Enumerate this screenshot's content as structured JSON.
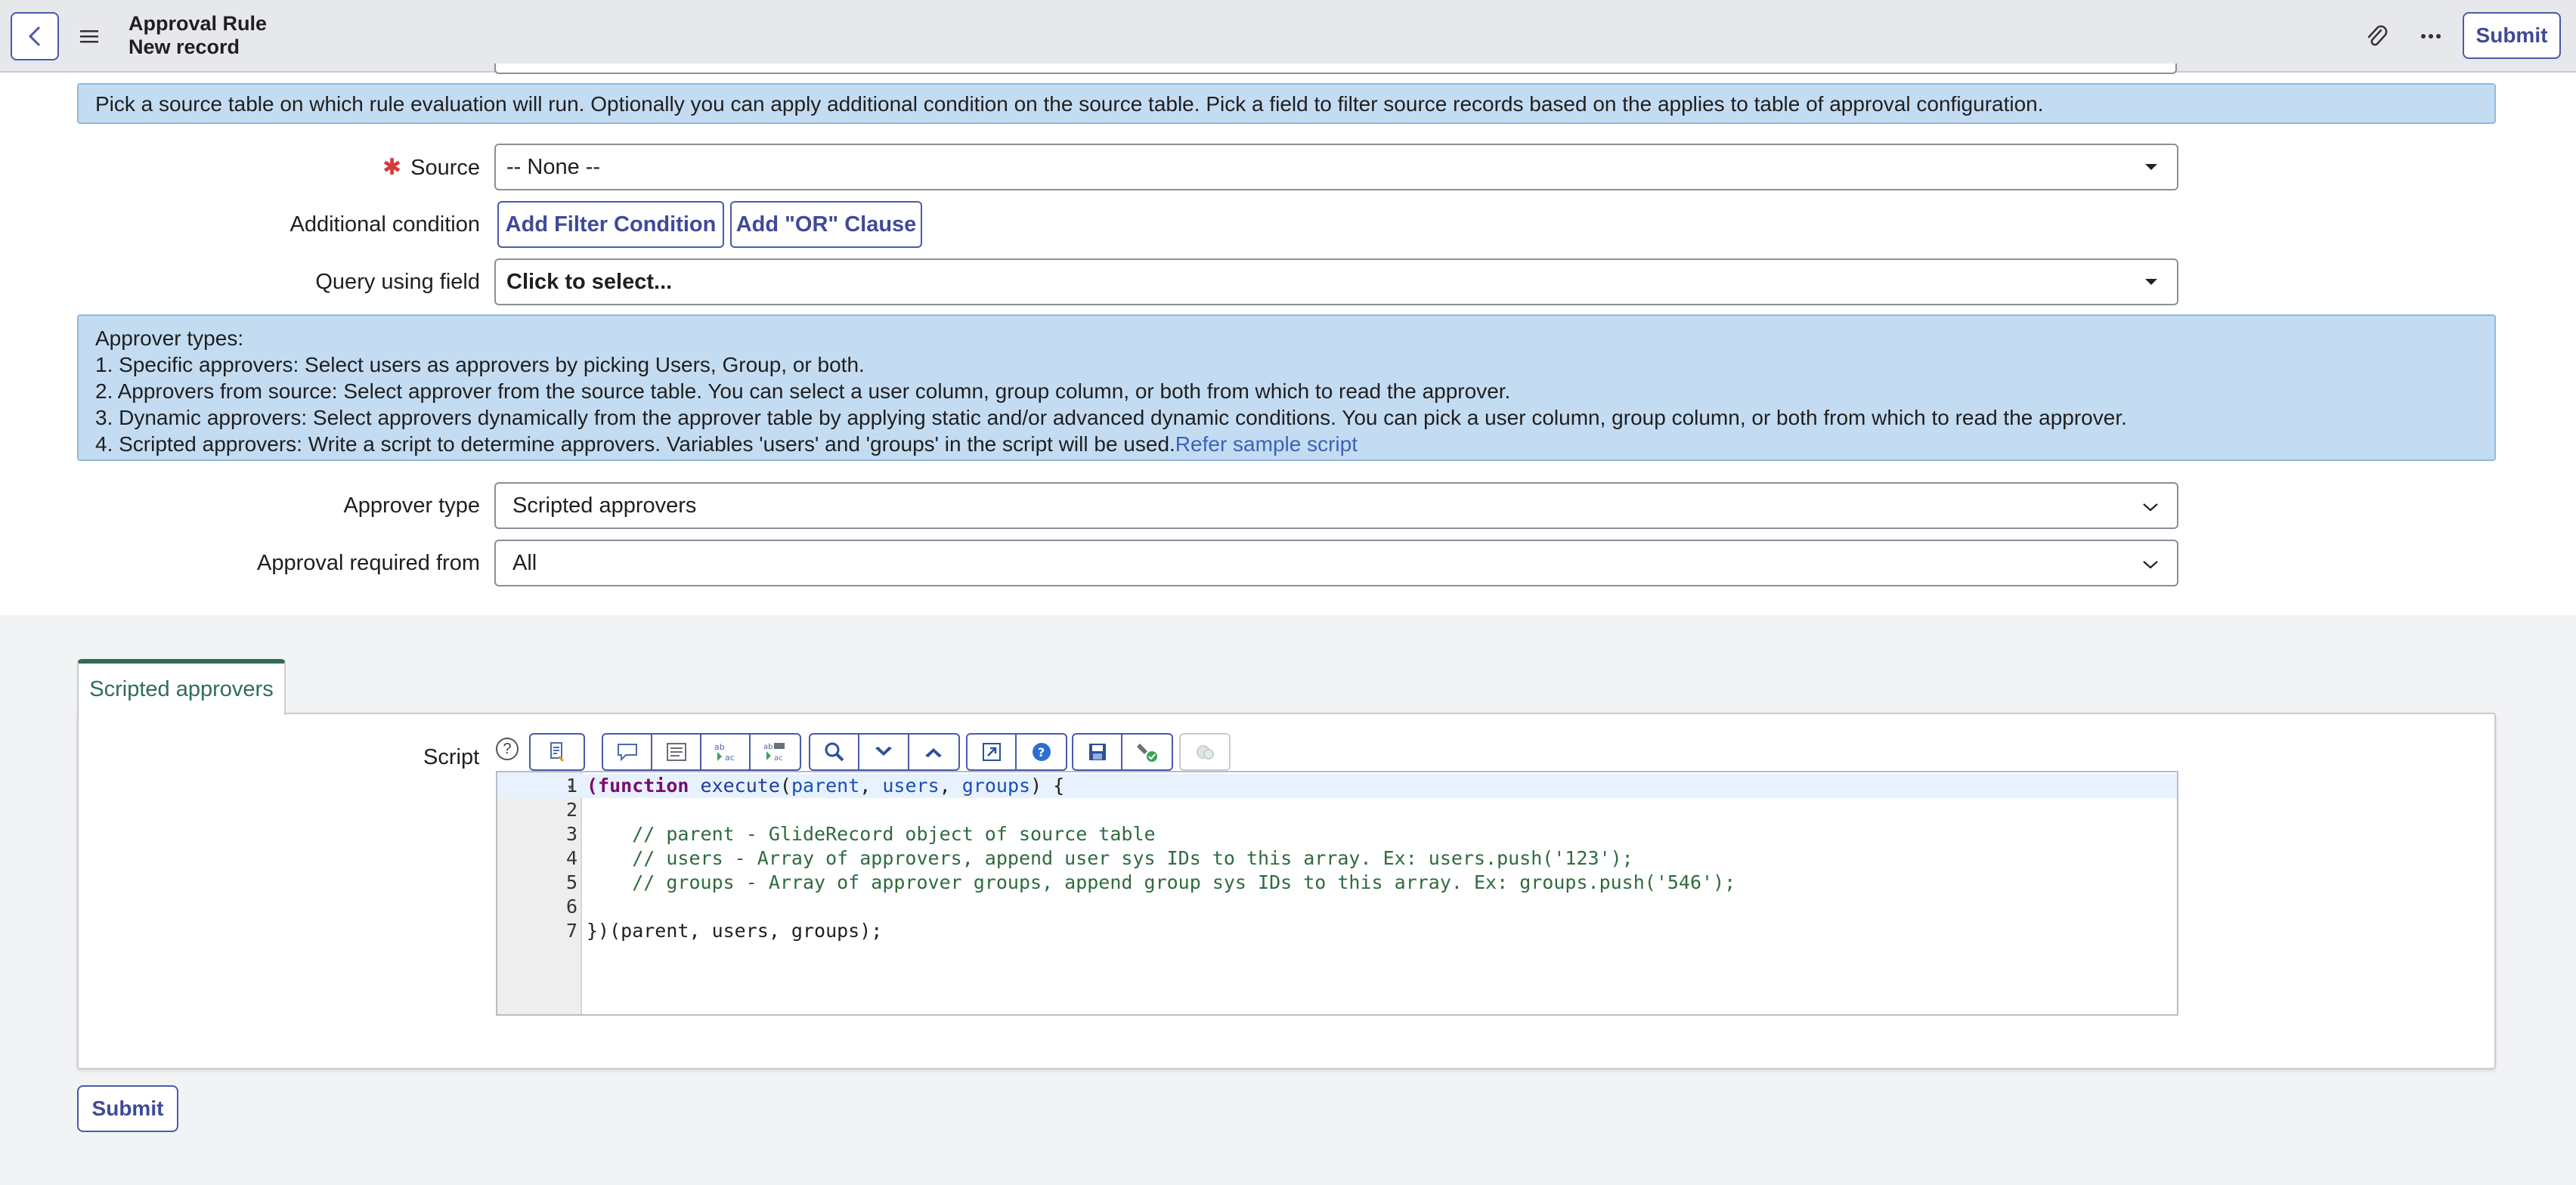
{
  "header": {
    "title": "Approval Rule",
    "subtitle": "New record",
    "submit_label": "Submit",
    "icons": [
      "back-icon",
      "menu-icon",
      "attachment-icon",
      "more-icon"
    ]
  },
  "info_source": "Pick a source table on which rule evaluation will run. Optionally you can apply additional condition on the source table. Pick a field to filter source records based on the applies to table of approval configuration.",
  "form": {
    "source": {
      "label": "Source",
      "required_mark": "✱",
      "value": "-- None --"
    },
    "additional_condition": {
      "label": "Additional condition",
      "add_filter_label": "Add Filter Condition",
      "add_or_label": "Add \"OR\" Clause"
    },
    "query_field": {
      "label": "Query using field",
      "value": "Click to select..."
    },
    "approver_type": {
      "label": "Approver type",
      "value": "Scripted approvers"
    },
    "approval_required": {
      "label": "Approval required from",
      "value": "All"
    }
  },
  "info_approver": {
    "heading": "Approver types:",
    "line1": "1. Specific approvers: Select users as approvers by picking Users, Group, or both.",
    "line2": "2. Approvers from source: Select approver from the source table. You can select a user column, group column, or both from which to read the approver.",
    "line3": "3. Dynamic approvers: Select approvers dynamically from the approver table by applying static and/or advanced dynamic conditions. You can pick a user column, group column, or both from which to read the approver.",
    "line4": "4. Scripted approvers: Write a script to determine approvers. Variables 'users' and 'groups' in the script will be used.",
    "link": "Refer sample script"
  },
  "tab": {
    "label": "Scripted approvers"
  },
  "script": {
    "label": "Script",
    "help": "?",
    "toolbar_icons": [
      "format-icon",
      "comment-icon",
      "align-icon",
      "replace-icon",
      "replace-all-icon",
      "search-icon",
      "search-next-icon",
      "search-prev-icon",
      "fullscreen-icon",
      "help-icon",
      "save-icon",
      "script-debug-icon",
      "disabled-icon"
    ],
    "lines": [
      {
        "num": "1",
        "kw": "(function",
        "fn": " execute",
        "p1": "(",
        "a1": "parent",
        "p2": ", ",
        "a2": "users",
        "p3": ", ",
        "a3": "groups",
        "p4": ") {"
      },
      {
        "num": "2",
        "text": ""
      },
      {
        "num": "3",
        "text": "    // parent - GlideRecord object of source table"
      },
      {
        "num": "4",
        "text": "    // users - Array of approvers, append user sys IDs to this array. Ex: users.push('123');"
      },
      {
        "num": "5",
        "text": "    // groups - Array of approver groups, append group sys IDs to this array. Ex: groups.push('546');"
      },
      {
        "num": "6",
        "text": ""
      },
      {
        "num": "7",
        "text": "})(parent, users, groups);"
      }
    ]
  },
  "footer": {
    "submit_label": "Submit"
  },
  "colors": {
    "accent": "#4c5aa8",
    "info_bg": "#c4dcf2",
    "tab_accent": "#2f6e52",
    "required": "#d93a3a"
  }
}
